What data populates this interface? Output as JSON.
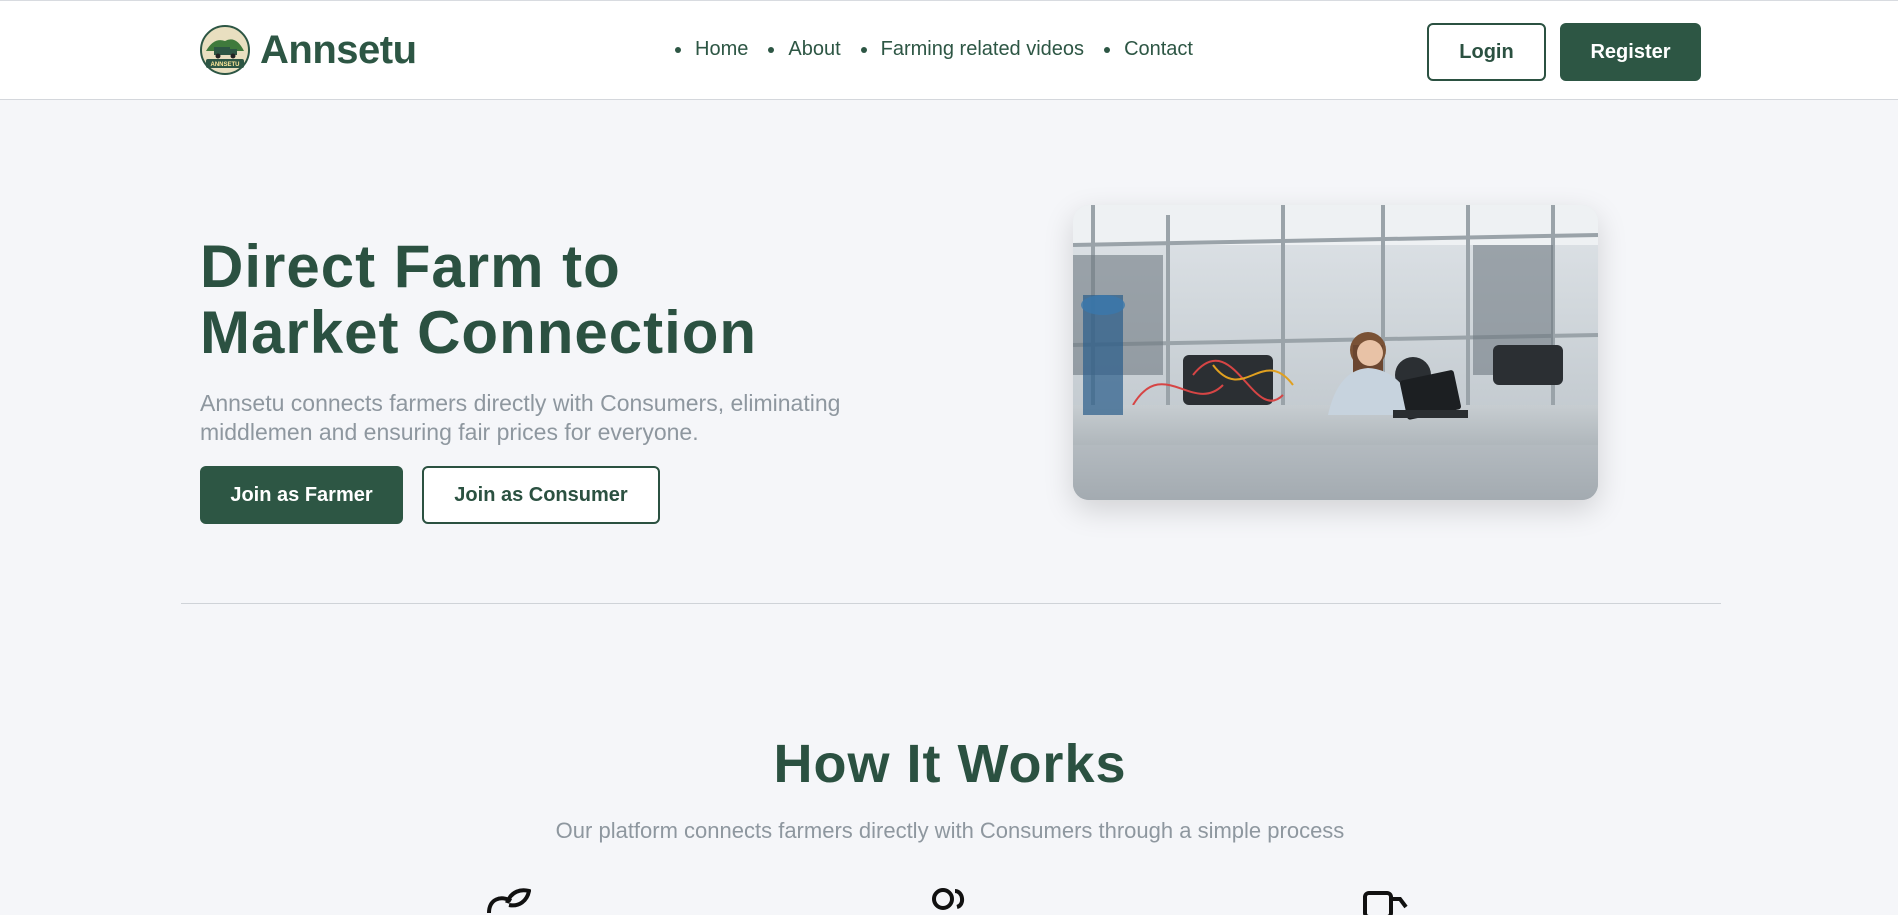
{
  "brand": {
    "name": "Annsetu",
    "badge_text": "ANNSETU"
  },
  "nav": {
    "items": [
      {
        "label": "Home"
      },
      {
        "label": "About"
      },
      {
        "label": "Farming related videos"
      },
      {
        "label": "Contact"
      }
    ]
  },
  "auth": {
    "login_label": "Login",
    "register_label": "Register"
  },
  "hero": {
    "title_line1": "Direct Farm to",
    "title_line2": "Market Connection",
    "subtitle": "Annsetu connects farmers directly with Consumers, eliminating middlemen and ensuring fair prices for everyone.",
    "farmer_button": "Join as Farmer",
    "consumer_button": "Join as Consumer",
    "image_subject": "engineer at workstation"
  },
  "how_it_works": {
    "title": "How It Works",
    "subtitle": "Our platform connects farmers directly with Consumers through a simple process",
    "step_icons": [
      "sprout-icon",
      "users-icon",
      "truck-icon"
    ]
  },
  "colors": {
    "brand_green": "#2d5644",
    "muted_text": "#8e979f",
    "background": "#f5f6f9"
  }
}
